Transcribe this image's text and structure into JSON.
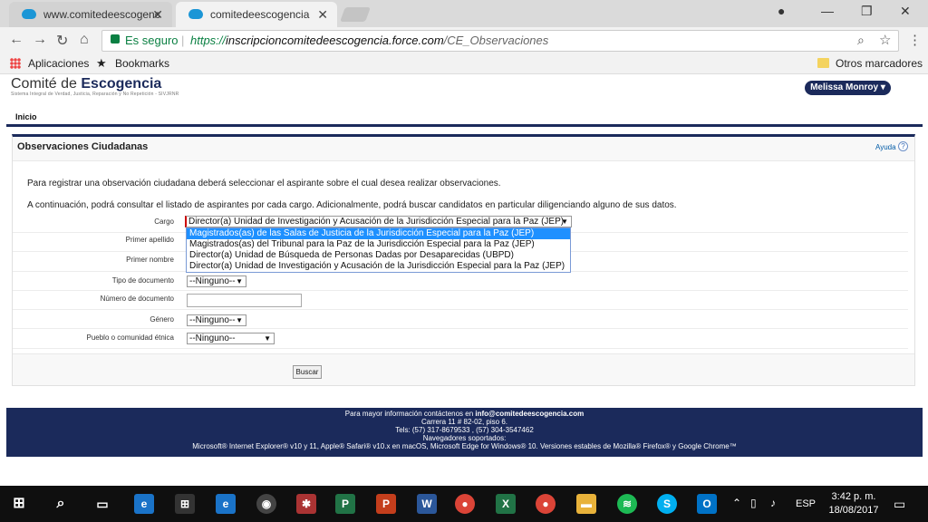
{
  "browser": {
    "tabs": [
      {
        "label": "www.comitedeescogenc"
      },
      {
        "label": "comitedeescogencia"
      }
    ],
    "secure_label": "Es seguro",
    "url_scheme": "https://",
    "url_host": "inscripcioncomitedeescogencia.force.com",
    "url_path": "/CE_Observaciones",
    "bookmarks": {
      "apps": "Aplicaciones",
      "bookmarks": "Bookmarks",
      "others": "Otros marcadores"
    }
  },
  "header": {
    "logo_plain": "Comité de ",
    "logo_bold": "Escogencia",
    "logo_sub": "Sistema Integral de Verdad, Justicia, Reparación y No Repetición - SIVJRNR",
    "user": "Melissa Monroy ▾",
    "nav_inicio": "Inicio"
  },
  "panel": {
    "title": "Observaciones Ciudadanas",
    "help": "Ayuda",
    "intro1": "Para registrar una observación ciudadana deberá seleccionar el aspirante sobre el cual desea realizar observaciones.",
    "intro2": "A continuación, podrá consultar el listado de aspirantes por cada cargo. Adicionalmente, podrá buscar candidatos en particular diligenciando alguno de sus datos."
  },
  "form": {
    "cargo_label": "Cargo",
    "cargo_value": "Director(a) Unidad de Investigación y Acusación de la Jurisdicción Especial para la Paz (JEP)",
    "cargo_options": [
      "Magistrados(as) de las Salas de Justicia de la Jurisdicción Especial para la Paz (JEP)",
      "Magistrados(as) del Tribunal para la Paz de la Jurisdicción Especial para la Paz (JEP)",
      "Director(a) Unidad de Búsqueda de Personas Dadas por Desaparecidas (UBPD)",
      "Director(a) Unidad de Investigación y Acusación de la Jurisdicción Especial para la Paz (JEP)"
    ],
    "primer_apellido_label": "Primer apellido",
    "primer_nombre_label": "Primer nombre",
    "tipo_documento_label": "Tipo de documento",
    "tipo_documento_value": "--Ninguno--",
    "numero_documento_label": "Número de documento",
    "genero_label": "Género",
    "genero_value": "--Ninguno--",
    "pueblo_label": "Pueblo o comunidad étnica",
    "pueblo_value": "--Ninguno--",
    "buscar": "Buscar"
  },
  "footer": {
    "line1_prefix": "Para mayor información contáctenos  en ",
    "email": "info@comitedeescogencia.com",
    "line2": "Carrera 11 # 82-02, piso 6.",
    "line3": "Tels: (57) 317-8679533 , (57) 304-3547462",
    "line4": "Navegadores soportados:",
    "line5": "Microsoft® Internet Explorer® v10 y 11, Apple® Safari® v10.x en macOS, Microsoft Edge for Windows® 10. Versiones estables de Mozilla® Firefox® y Google Chrome™"
  },
  "taskbar": {
    "lang": "ESP",
    "time": "3:42 p. m.",
    "date": "18/08/2017"
  }
}
